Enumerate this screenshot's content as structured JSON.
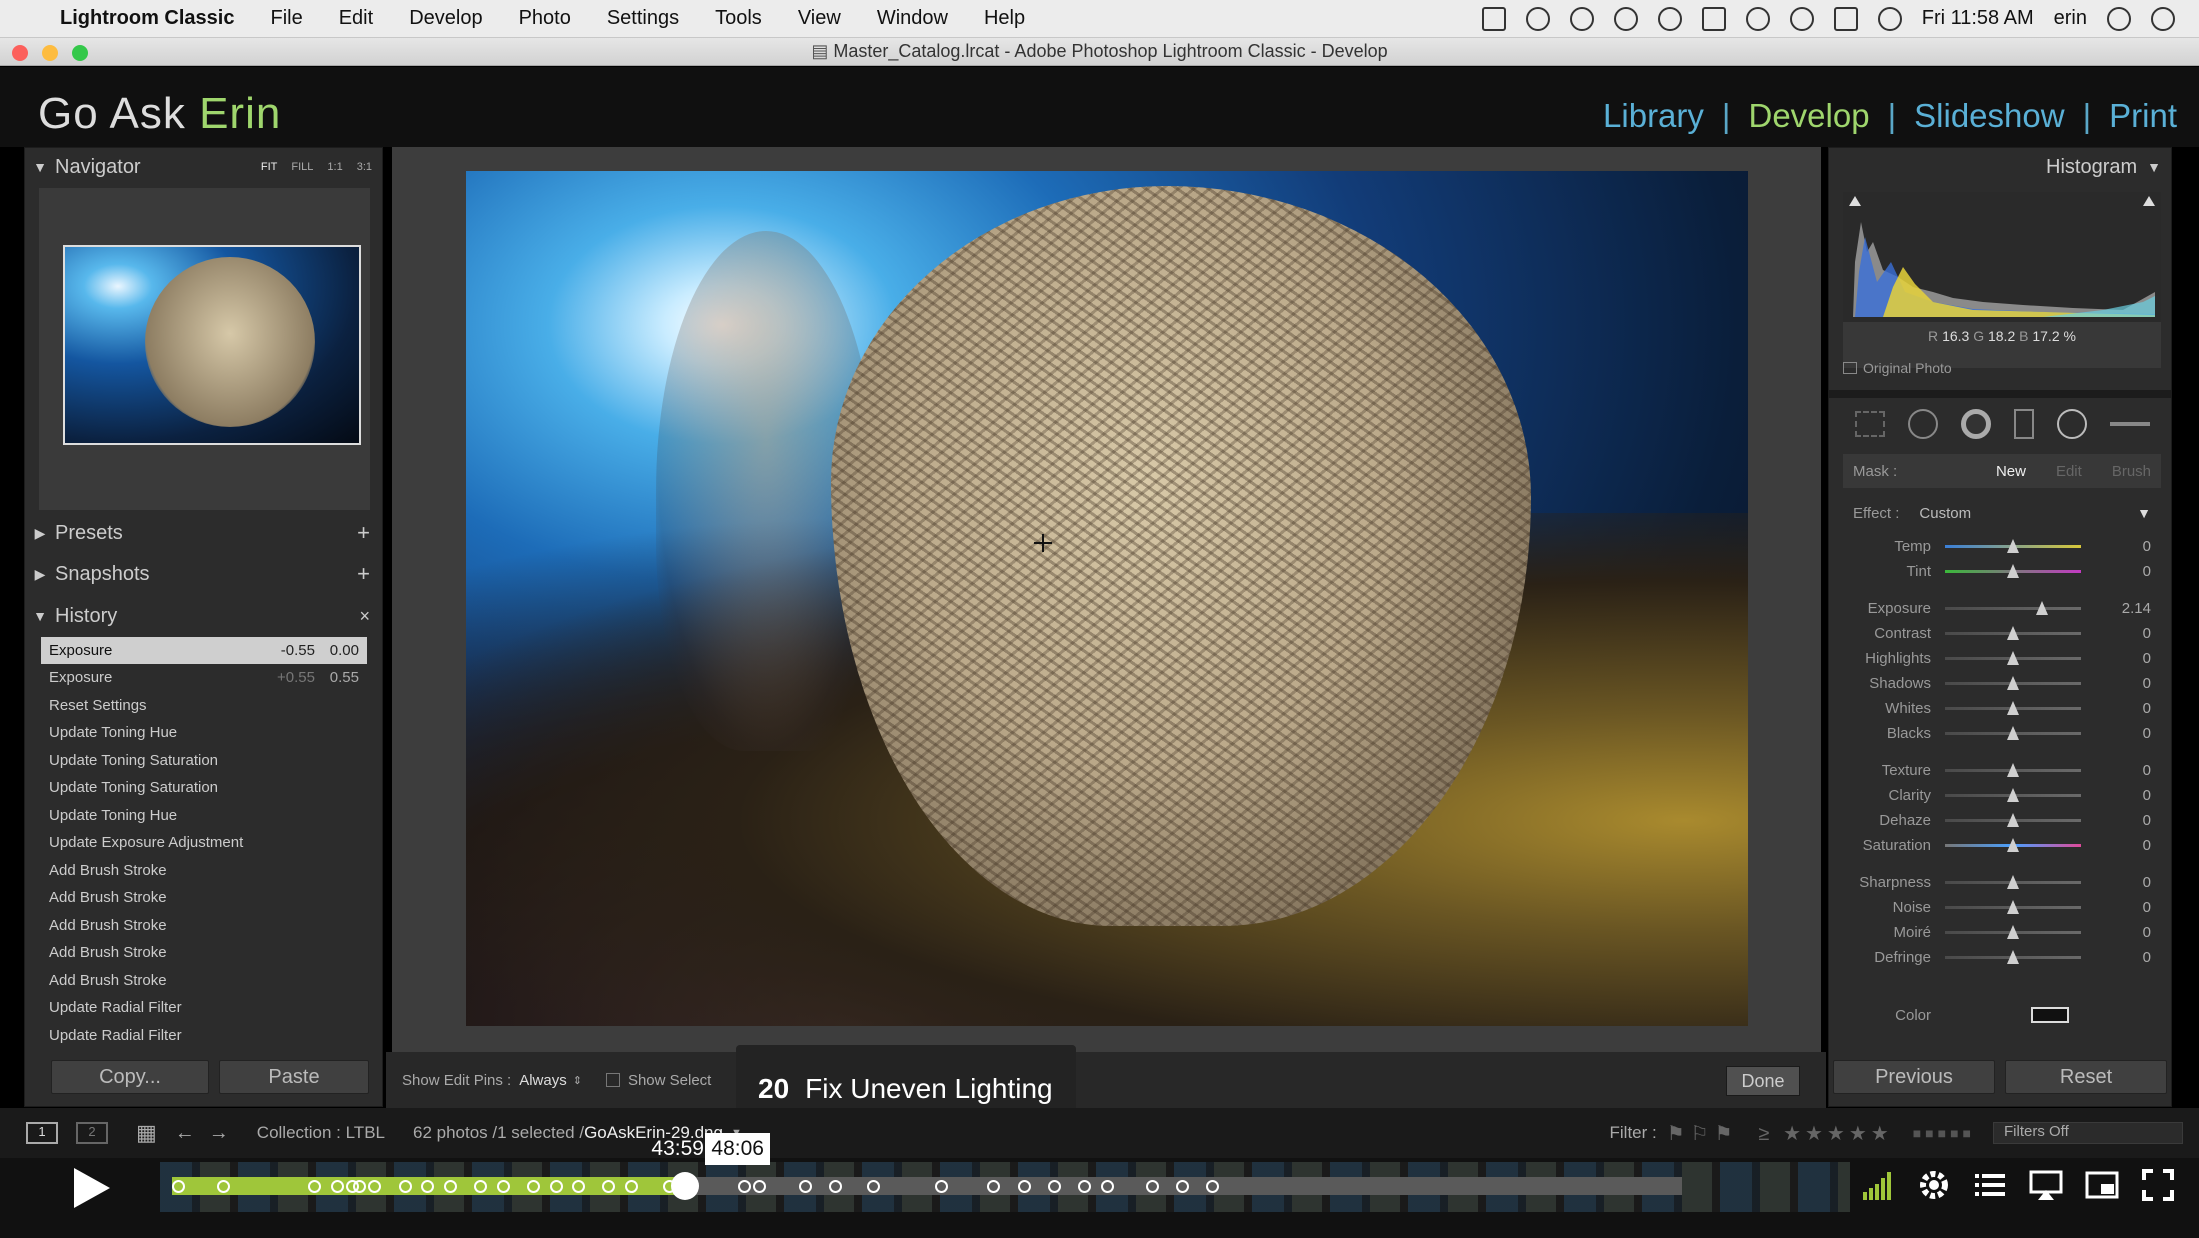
{
  "menubar": {
    "app": "Lightroom Classic",
    "items": [
      "File",
      "Edit",
      "Develop",
      "Photo",
      "Settings",
      "Tools",
      "View",
      "Window",
      "Help"
    ],
    "clock": "Fri 11:58 AM",
    "user": "erin"
  },
  "window": {
    "title": "Master_Catalog.lrcat - Adobe Photoshop Lightroom Classic - Develop"
  },
  "header": {
    "brand_main": "Go Ask",
    "brand_accent": "Erin",
    "modules": [
      {
        "label": "Library",
        "color": "#5ab0d6"
      },
      {
        "label": "Develop",
        "color": "#9fd66d"
      },
      {
        "label": "Slideshow",
        "color": "#5ab0d6"
      },
      {
        "label": "Print",
        "color": "#5ab0d6"
      }
    ]
  },
  "left_panel": {
    "navigator": {
      "title": "Navigator",
      "zoom_options": [
        "FIT",
        "FILL",
        "1:1",
        "3:1"
      ]
    },
    "presets": "Presets",
    "snapshots": "Snapshots",
    "history": {
      "title": "History",
      "items": [
        {
          "label": "Exposure",
          "before": "-0.55",
          "after": "0.00",
          "selected": true
        },
        {
          "label": "Exposure",
          "before": "+0.55",
          "after": "0.55"
        },
        {
          "label": "Reset Settings"
        },
        {
          "label": "Update Toning Hue"
        },
        {
          "label": "Update Toning Saturation"
        },
        {
          "label": "Update Toning Saturation"
        },
        {
          "label": "Update Toning Hue"
        },
        {
          "label": "Update Exposure Adjustment"
        },
        {
          "label": "Add Brush Stroke"
        },
        {
          "label": "Add Brush Stroke"
        },
        {
          "label": "Add Brush Stroke"
        },
        {
          "label": "Add Brush Stroke"
        },
        {
          "label": "Add Brush Stroke"
        },
        {
          "label": "Update Radial Filter"
        },
        {
          "label": "Update Radial Filter"
        }
      ]
    },
    "copy_button": "Copy...",
    "paste_button": "Paste"
  },
  "toolbar": {
    "show_edit_pins_label": "Show Edit Pins :",
    "show_edit_pins_value": "Always",
    "show_selected_label": "Show Select",
    "done": "Done"
  },
  "chapter": {
    "number": "20",
    "title": "Fix Uneven Lighting"
  },
  "right_panel": {
    "histogram": {
      "title": "Histogram",
      "r_label": "R",
      "r": "16.3",
      "g_label": "G",
      "g": "18.2",
      "b_label": "B",
      "b": "17.2 %",
      "original_photo": "Original Photo"
    },
    "mask": {
      "label": "Mask :",
      "new": "New",
      "edit": "Edit",
      "brush": "Brush"
    },
    "effect": {
      "label": "Effect :",
      "value": "Custom"
    },
    "sliders": [
      {
        "label": "Temp",
        "value": "0",
        "pos": 0.5,
        "track": "temp"
      },
      {
        "label": "Tint",
        "value": "0",
        "pos": 0.5,
        "track": "tint"
      },
      {
        "label": "Exposure",
        "value": "2.14",
        "pos": 0.71,
        "track": "gray"
      },
      {
        "label": "Contrast",
        "value": "0",
        "pos": 0.5,
        "track": "gray"
      },
      {
        "label": "Highlights",
        "value": "0",
        "pos": 0.5,
        "track": "gray"
      },
      {
        "label": "Shadows",
        "value": "0",
        "pos": 0.5,
        "track": "gray"
      },
      {
        "label": "Whites",
        "value": "0",
        "pos": 0.5,
        "track": "gray"
      },
      {
        "label": "Blacks",
        "value": "0",
        "pos": 0.5,
        "track": "gray"
      },
      {
        "label": "Texture",
        "value": "0",
        "pos": 0.5,
        "track": "gray"
      },
      {
        "label": "Clarity",
        "value": "0",
        "pos": 0.5,
        "track": "gray"
      },
      {
        "label": "Dehaze",
        "value": "0",
        "pos": 0.5,
        "track": "gray"
      },
      {
        "label": "Saturation",
        "value": "0",
        "pos": 0.5,
        "track": "sat"
      },
      {
        "label": "Sharpness",
        "value": "0",
        "pos": 0.5,
        "track": "gray"
      },
      {
        "label": "Noise",
        "value": "0",
        "pos": 0.5,
        "track": "gray"
      },
      {
        "label": "Moiré",
        "value": "0",
        "pos": 0.5,
        "track": "gray"
      },
      {
        "label": "Defringe",
        "value": "0",
        "pos": 0.5,
        "track": "gray"
      }
    ],
    "color_label": "Color",
    "previous": "Previous",
    "reset": "Reset"
  },
  "filmstrip": {
    "collection": "Collection : LTBL",
    "count": "62 photos /1 selected /",
    "filename": "GoAskErin-29.dng",
    "filter_label": "Filter :",
    "filters_off": "Filters Off"
  },
  "player": {
    "current_time": "43:59",
    "hover_time": "48:06",
    "progress": 0.34,
    "scrub_fraction": 0.34,
    "chapter_marks": [
      0.0,
      0.03,
      0.09,
      0.105,
      0.115,
      0.12,
      0.13,
      0.15,
      0.165,
      0.18,
      0.2,
      0.215,
      0.235,
      0.25,
      0.265,
      0.285,
      0.3,
      0.325,
      0.375,
      0.385,
      0.415,
      0.435,
      0.46,
      0.505,
      0.54,
      0.56,
      0.58,
      0.6,
      0.615,
      0.645,
      0.665,
      0.685
    ]
  }
}
